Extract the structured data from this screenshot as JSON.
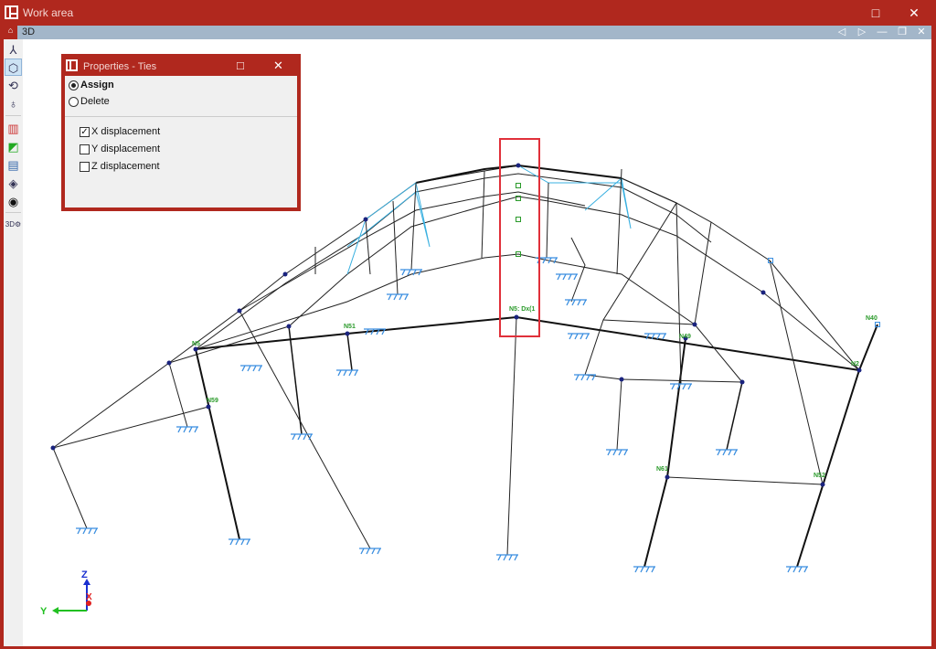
{
  "window": {
    "title": "Work area",
    "maximize_icon": "□",
    "close_icon": "✕"
  },
  "view": {
    "title": "3D",
    "buttons": [
      "◁",
      "▷",
      "—",
      "❐",
      "✕"
    ]
  },
  "toolbar": {
    "icons": [
      "axes-icon",
      "view-3d-icon",
      "orbit-icon",
      "rotate-icon",
      "section-icon",
      "plane-icon",
      "window-icon",
      "layers-icon",
      "visibility-icon",
      "3d-settings-icon"
    ]
  },
  "dialog": {
    "title": "Properties - Ties",
    "maximize_icon": "□",
    "close_icon": "✕",
    "mode_options": [
      {
        "label": "Assign",
        "selected": true
      },
      {
        "label": "Delete",
        "selected": false
      }
    ],
    "checks": [
      {
        "label": "X displacement",
        "checked": true
      },
      {
        "label": "Y displacement",
        "checked": false
      },
      {
        "label": "Z displacement",
        "checked": false
      }
    ]
  },
  "nodes": [
    {
      "label": "N5"
    },
    {
      "label": "N59"
    },
    {
      "label": "N51"
    },
    {
      "label": "N5: Dx(1"
    },
    {
      "label": "N49"
    },
    {
      "label": "N2"
    },
    {
      "label": "N40"
    },
    {
      "label": "N61"
    },
    {
      "label": "N52"
    }
  ],
  "axes": {
    "z": "Z",
    "x": "X",
    "y": "Y"
  },
  "colors": {
    "frame": "#b0281e",
    "highlight": "#e0303a",
    "support": "#3a8ee0",
    "node": "#1a237e",
    "label": "#2a9a2a"
  }
}
